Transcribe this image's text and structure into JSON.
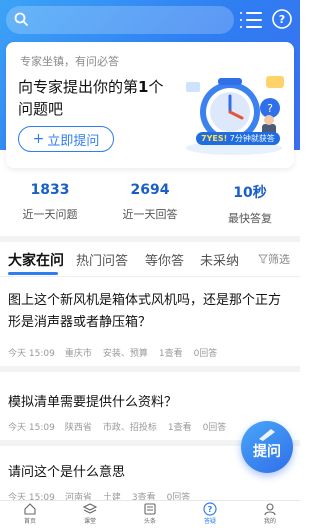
{
  "header": {
    "search_placeholder": ""
  },
  "card": {
    "subtitle": "专家坐镇，有问必答",
    "title_part1": "向专家提出你的第",
    "title_number": "1",
    "title_part2": "个问题吧",
    "ask_button": "立即提问",
    "badge_prefix": "7YES!",
    "badge_suffix": "7分钟就获答"
  },
  "stats": [
    {
      "value": "1833",
      "label": "近一天问题"
    },
    {
      "value": "2694",
      "label": "近一天回答"
    },
    {
      "value": "10秒",
      "label": "最快答复"
    }
  ],
  "tabs": [
    {
      "label": "大家在问",
      "active": true
    },
    {
      "label": "热门问答",
      "active": false
    },
    {
      "label": "等你答",
      "active": false
    },
    {
      "label": "未采纳",
      "active": false
    }
  ],
  "filter_label": "筛选",
  "questions": [
    {
      "title": "图上这个新风机是箱体式风机吗，还是那个正方形是消声器或者静压箱？",
      "time": "今天 15:09",
      "region": "重庆市",
      "tags": "安装、预算",
      "views": "1查看",
      "answers": "0回答"
    },
    {
      "title": "模拟清单需要提供什么资料？",
      "time": "今天 15:09",
      "region": "陕西省",
      "tags": "市政、招投标",
      "views": "1查看",
      "answers": "0回答"
    },
    {
      "title": "请问这个是什么意思",
      "time": "今天 15:09",
      "region": "河南省",
      "tags": "土建",
      "views": "3查看",
      "answers": "0回答"
    }
  ],
  "fab_label": "提问",
  "nav": [
    {
      "label": "首页",
      "icon": "home-icon",
      "active": false
    },
    {
      "label": "课堂",
      "icon": "layers-icon",
      "active": false
    },
    {
      "label": "头条",
      "icon": "news-icon",
      "active": false
    },
    {
      "label": "答疑",
      "icon": "question-icon",
      "active": true
    },
    {
      "label": "我的",
      "icon": "user-icon",
      "active": false
    }
  ],
  "colors": {
    "brand": "#2f7df2",
    "stat_number": "#1a5fc7",
    "badge_highlight": "#ffe04d"
  }
}
